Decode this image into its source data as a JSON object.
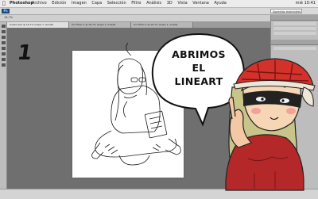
{
  "menubar": {
    "app": "Photoshop",
    "items": [
      "Archivo",
      "Edición",
      "Imagen",
      "Capa",
      "Selección",
      "Filtro",
      "Análisis",
      "3D",
      "Vista",
      "Ventana",
      "Ayuda"
    ],
    "clock": "mié 10:41"
  },
  "appbar": {
    "logo": "Ps",
    "workspace": "Aspectos esenciales"
  },
  "optbar": {
    "zoom": "16,7%"
  },
  "tabs": [
    {
      "label": "lineart.psd @ 16,7% (Capa 1, Gris/8)"
    },
    {
      "label": "Sin título-1 @ 16,7% (Capa 1, Gris/8)"
    },
    {
      "label": "Sin título-2 @ 16,7% (Capa 1, Gris/8)"
    }
  ],
  "step_number": "1",
  "speech_bubble": {
    "lines": [
      "ABRIMOS",
      "EL",
      "LINEART"
    ]
  },
  "colors": {
    "menubar": "#ececec",
    "workspace": "#6f6f6f",
    "document": "#ffffff",
    "hat_red": "#d2322a",
    "sweater_red": "#b5282a",
    "hair": "#c9c48a",
    "mask": "#222222"
  }
}
